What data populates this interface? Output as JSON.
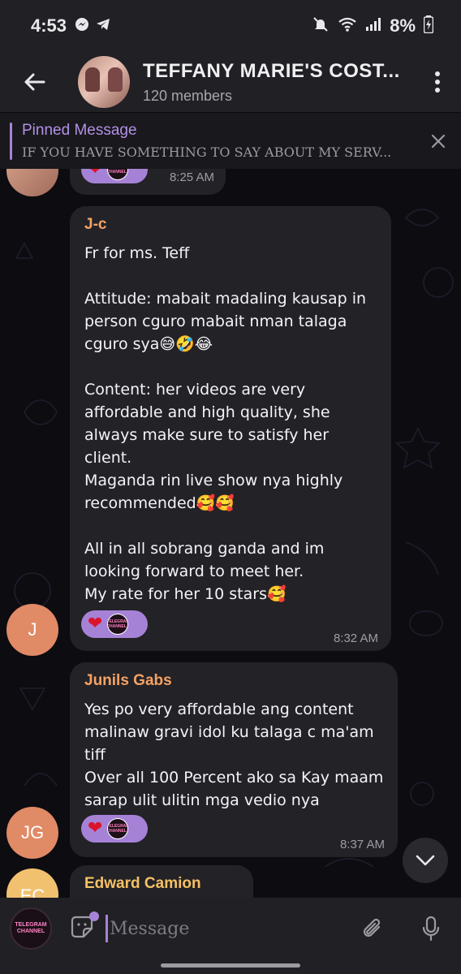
{
  "status_bar": {
    "time": "4:53",
    "battery": "8%",
    "left_icons": [
      "messenger-icon",
      "telegram-icon"
    ],
    "right_icons": [
      "mute-icon",
      "wifi-icon",
      "signal-icon",
      "battery-charging-icon"
    ]
  },
  "header": {
    "title": "TEFFANY MARIE'S COST...",
    "subtitle": "120 members"
  },
  "pinned": {
    "title": "Pinned Message",
    "text": "IF YOU HAVE SOMETHING TO SAY ABOUT MY SERV..."
  },
  "messages": [
    {
      "time": "8:25 AM"
    },
    {
      "sender": "J-c",
      "sender_color": "#f4a264",
      "avatar_initials": "J",
      "avatar_color": "#e08a66",
      "text": "Fr for ms. Teff\n\nAttitude: mabait madaling kausap in person cguro mabait nman talaga cguro sya😅🤣😂\n\nContent: her videos are very affordable and high quality, she always make sure to satisfy her client.\nMaganda rin live show nya highly recommended🥰🥰\n\nAll in all sobrang ganda and im looking forward to meet her.\nMy rate for her 10 stars🥰",
      "time": "8:32 AM"
    },
    {
      "sender": "Junils Gabs",
      "sender_color": "#f4a264",
      "avatar_initials": "JG",
      "avatar_color": "#e08a66",
      "text": "Yes po very affordable ang content malinaw gravi idol ku talaga c ma'am tiff\nOver all 100 Percent ako sa Kay maam sarap ulit ulitin mga vedio nya",
      "time": "8:37 AM"
    },
    {
      "sender": "Edward Camion",
      "sender_color": "#f5c163",
      "avatar_initials": "EC",
      "avatar_color": "#f2c16f"
    }
  ],
  "reaction_badge_text": "TELEGRAM CHANNEL",
  "input": {
    "placeholder": "Message"
  },
  "colors": {
    "accent": "#a783d6",
    "heart": "#d9142b",
    "background": "#0d0c10",
    "bubble": "#232227"
  }
}
